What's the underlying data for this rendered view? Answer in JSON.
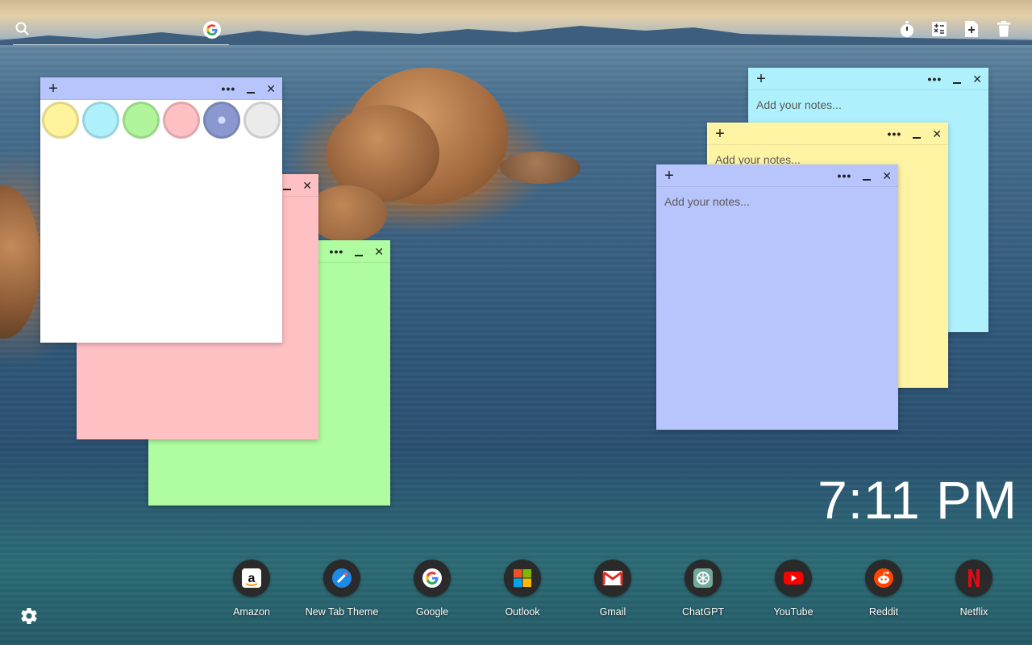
{
  "search": {
    "icon": "search-icon",
    "engine_icon": "google-icon"
  },
  "toolbar": {
    "tools": [
      {
        "name": "timer-icon"
      },
      {
        "name": "calculator-icon"
      },
      {
        "name": "add-note-icon"
      },
      {
        "name": "trash-icon"
      }
    ]
  },
  "notes": {
    "placeholder": "Add your notes...",
    "plus": "+",
    "dots": "•••",
    "close": "✕",
    "colors": {
      "white": "#ffffff",
      "pink": "#ffc0c4",
      "green": "#b0fca0",
      "cyan": "#aef1fc",
      "yellow": "#fff4a4",
      "blue": "#b8c4fc"
    },
    "swatches": [
      "#fff39c",
      "#aef1fc",
      "#b0f59c",
      "#ffc0c4",
      "#8a98cf",
      "#ebebeb"
    ]
  },
  "clock": {
    "time": "7:11 PM"
  },
  "dock": {
    "items": [
      {
        "label": "Amazon",
        "icon": "amazon-icon"
      },
      {
        "label": "New Tab Theme",
        "icon": "new-tab-theme-icon"
      },
      {
        "label": "Google",
        "icon": "google-icon"
      },
      {
        "label": "Outlook",
        "icon": "outlook-icon"
      },
      {
        "label": "Gmail",
        "icon": "gmail-icon"
      },
      {
        "label": "ChatGPT",
        "icon": "chatgpt-icon"
      },
      {
        "label": "YouTube",
        "icon": "youtube-icon"
      },
      {
        "label": "Reddit",
        "icon": "reddit-icon"
      },
      {
        "label": "Netflix",
        "icon": "netflix-icon"
      }
    ]
  },
  "settings": {
    "icon": "gear-icon"
  }
}
